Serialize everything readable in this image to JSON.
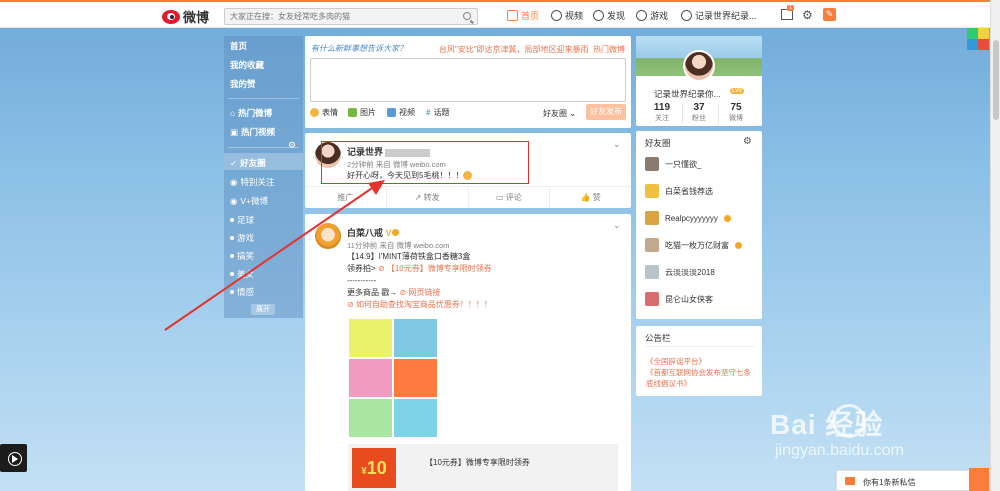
{
  "topbar": {
    "logo_text": "微博",
    "search_placeholder": "大家正在搜：女友经常吃多肉的猫",
    "nav": [
      {
        "label": "首页",
        "active": true,
        "icon": "home-icon"
      },
      {
        "label": "视频",
        "active": false,
        "icon": "video-icon"
      },
      {
        "label": "发现",
        "active": false,
        "icon": "compass-icon"
      },
      {
        "label": "游戏",
        "active": false,
        "icon": "gamepad-icon"
      },
      {
        "label": "记录世界纪录...",
        "active": false,
        "icon": "user-icon"
      }
    ],
    "mail_badge": "1",
    "accent": "#fa7d3c"
  },
  "sidebar": {
    "items": [
      "首页",
      "我的收藏",
      "我的赞",
      "热门微博",
      "热门视频",
      "好友圈",
      "特别关注",
      "V+微博",
      "足球",
      "游戏",
      "搞笑",
      "美女",
      "情感"
    ],
    "more": "展开"
  },
  "publisher": {
    "prompt": "有什么新鲜事想告诉大家？",
    "hot_text": "台风\"安比\"即达京津冀，局部地区迎来暴雨",
    "hot_label": "热门微博",
    "tools": [
      "表情",
      "图片",
      "视频",
      "话题"
    ],
    "visibility": "好友圈",
    "submit": "好友发布"
  },
  "post1": {
    "name": "记录世界",
    "meta": "2分钟前 来自 微博 weibo.com",
    "text": "好开心呀，今天见到5毛桃！！！",
    "actions": [
      "推广",
      "转发",
      "评论",
      "赞"
    ]
  },
  "post2": {
    "name": "白菜八戒",
    "meta": "11分钟前 来自 微博 weibo.com",
    "line1": "【14.9】I'MINT薄荷铁盒口香糖3盒",
    "line2_prefix": "领券拍>",
    "line2_link": "【10元券】微博专享限时领券",
    "separator": "-----------",
    "line3_prefix": "更多商品 戳→",
    "line3_link": "网页链接",
    "line4_link": "如何自助查找淘宝商品优惠券！！！！",
    "promo_amount": "10",
    "promo_title": "【10元券】微博专享限时领券",
    "image_colors": [
      "#e9f26a",
      "#7ec8e3",
      "#f39ac0",
      "#ff7a3d",
      "#a8e6a1",
      "#7fd3e6"
    ]
  },
  "profile": {
    "name": "记录世界纪录你...",
    "level": "Lv9",
    "stats": [
      {
        "num": "119",
        "label": "关注"
      },
      {
        "num": "37",
        "label": "粉丝"
      },
      {
        "num": "75",
        "label": "微博"
      }
    ]
  },
  "friends": {
    "title": "好友圈",
    "items": [
      {
        "name": "一只懂欲_",
        "badge": false,
        "color": "#8a7b6e"
      },
      {
        "name": "白菜省钱荐选",
        "badge": false,
        "color": "#f0c040"
      },
      {
        "name": "Realpcyyyyyyy",
        "badge": true,
        "color": "#d9a441"
      },
      {
        "name": "吃猫一枚万亿财富",
        "badge": true,
        "color": "#c2a88d"
      },
      {
        "name": "云淡淡淡2018",
        "badge": false,
        "color": "#b8c4cc"
      },
      {
        "name": "昆仑山女侠客",
        "badge": false,
        "color": "#d96c6c"
      }
    ]
  },
  "announcement": {
    "title": "公告栏",
    "links": [
      "《全国辟谣平台》",
      "《首都互联网协会发布坚守七条底线倡议书》"
    ]
  },
  "message_bar": {
    "text": "你有1条新私信"
  },
  "watermark": {
    "main": "Bai  经验",
    "sub": "jingyan.baidu.com"
  }
}
